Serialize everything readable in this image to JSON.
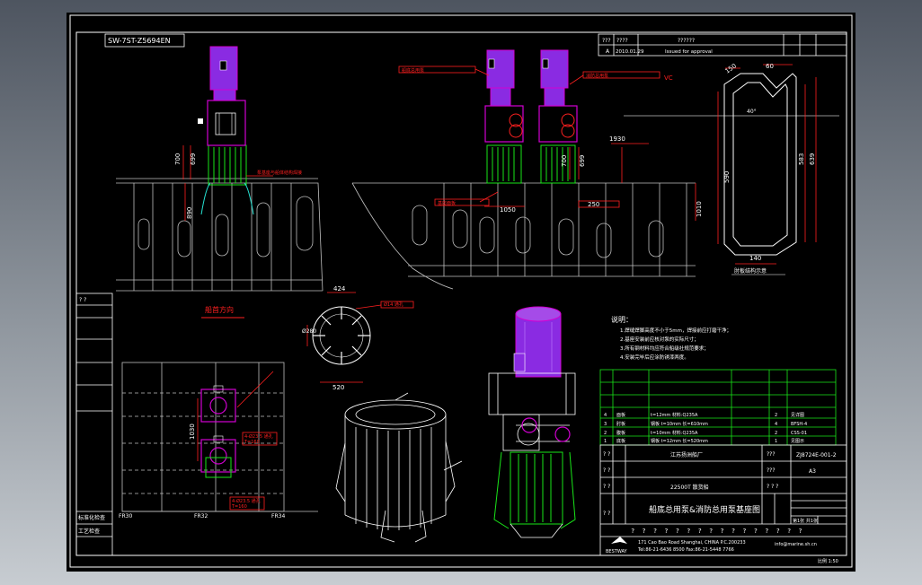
{
  "drawing": {
    "background": "#000000",
    "frame_code": "SW-7ST-Z5694EN",
    "revision_row": {
      "date": "2010.01.29",
      "note": "Issued for approval"
    },
    "direction_label": "船首方向",
    "title_main": "船底总用泵&消防总用泵基座图",
    "ship_name": "22500T 散货船",
    "yard_name": "江苏扬洲船厂",
    "drawing_no": "ZJ8724E-001-2",
    "sheet": "A3",
    "scale": "比例 1:50",
    "sheet_info": "第1张 共1张",
    "side_labels": [
      "批准",
      "审核",
      "标准化检查",
      "工艺检查"
    ],
    "frame_markers": [
      "FR30",
      "FR32",
      "FR34"
    ],
    "notes_title": "说明：",
    "notes": [
      "1.焊缝焊脚高度不小于5mm，焊接前应打磨干净；",
      "2.基座安装前应核对泵的实际尺寸；",
      "3.所有钢材料均应符合船级社规范要求；",
      "4.安装完毕后应涂防锈漆两度。"
    ],
    "company": {
      "address": "171 Cao Bao Road Shanghai, CHINA   P.C.200233",
      "phone": "Tel:86-21-6436 8500   Fax:86-21-5448 7766",
      "email": "info@marine.sh.cn",
      "logo_text": "BESTWAY"
    },
    "detail_caption": "肘板结构示意",
    "bom_rows": [
      {
        "no": "4",
        "name": "面板",
        "spec": "t=12mm 材料:Q235A",
        "qty": "2",
        "remark": "见详图"
      },
      {
        "no": "3",
        "name": "肘板",
        "spec": "钢板 t=10mm 长=610mm",
        "qty": "4",
        "remark": "BFSH-4"
      },
      {
        "no": "2",
        "name": "腹板",
        "spec": "t=10mm 材料:Q235A",
        "qty": "2",
        "remark": "CSS-01"
      },
      {
        "no": "1",
        "name": "底板",
        "spec": "钢板 t=12mm 长=520mm",
        "qty": "1",
        "remark": "见图示"
      }
    ]
  },
  "dims": {
    "front_left_a": "700",
    "front_left_b": "699",
    "front_left_h": "890",
    "front_right_a": "700",
    "front_right_b": "699",
    "front_right_c": "1930",
    "front_right_d": "1050",
    "front_right_h": "1010",
    "front_right_e": "250",
    "circle_top": "424",
    "circle_bottom": "520",
    "circle_left": "Ø280",
    "plan_h": "1030",
    "detail_top": "150",
    "detail_top2": "60",
    "detail_left": "590",
    "detail_right": "583",
    "detail_right2": "639",
    "detail_bottom": "140",
    "detail_angle": "40°"
  },
  "callouts": {
    "front_left_tag": "泵基座与船体结构焊接",
    "front_right_tag1": "船底总用泵",
    "front_right_tag2": "消防总用泵",
    "front_right_tag3": "基座面板",
    "circle_tag": "Ø14 通孔",
    "plan_tag1": "4-Ø23.5 通孔",
    "plan_tag2": "4-Ø23.5 通孔",
    "plan_tag1b": "T=160",
    "plan_tag2b": "T=160",
    "ve_label": "VC"
  },
  "colors": {
    "white": "#ffffff",
    "purple": "#8a2be2",
    "magenta": "#d100d1",
    "green": "#19e619",
    "cyan": "#26e0d0",
    "red": "#ff2020",
    "yellow": "#ffff00",
    "grey": "#a0a0a0"
  }
}
